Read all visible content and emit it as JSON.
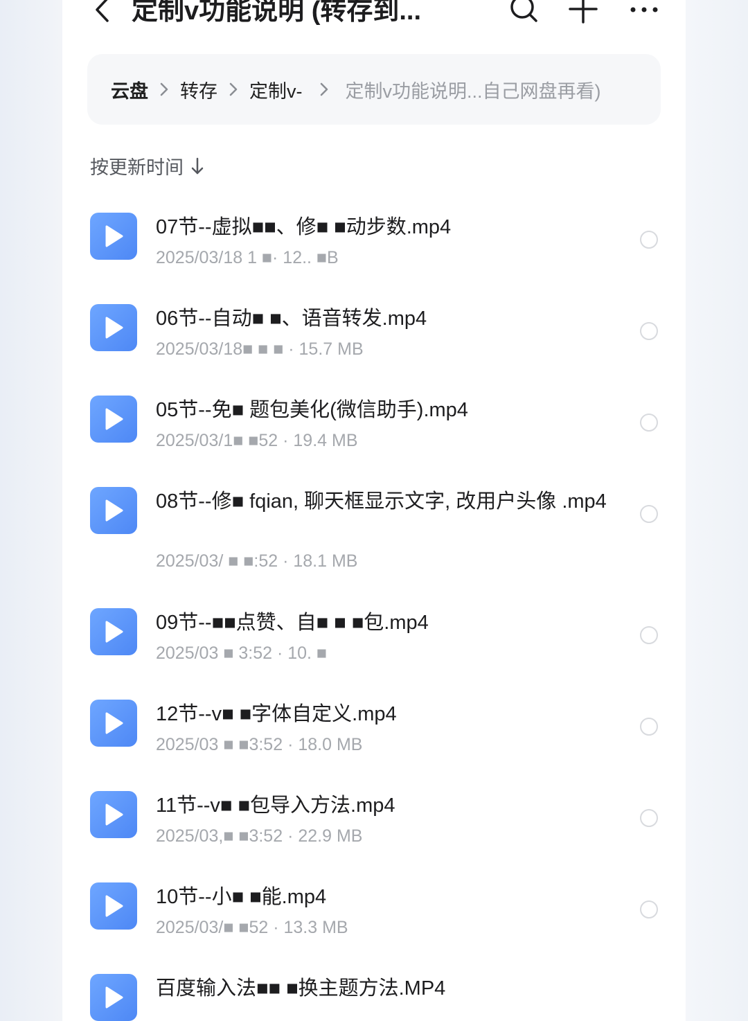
{
  "header": {
    "title": "定制v功能说明 (转存到...",
    "icons": [
      "back-icon",
      "search-icon",
      "plus-icon",
      "more-icon"
    ]
  },
  "breadcrumb": {
    "items": [
      "云盘",
      "转存",
      "定制v-",
      "定制v功能说明...自己网盘再看)"
    ]
  },
  "sort": {
    "label": "按更新时间"
  },
  "files": [
    {
      "name": "07节--虚拟■■、修■ ■动步数.mp4",
      "meta": "2025/03/18 1  ■· 12.. ■B"
    },
    {
      "name": "06节--自动■ ■、语音转发.mp4",
      "meta": "2025/03/18■ ■ ■ · 15.7 MB"
    },
    {
      "name": "05节--免■ 题包美化(微信助手).mp4",
      "meta": "2025/03/1■ ■52 · 19.4 MB"
    },
    {
      "name": "08节--修■ fqian, 聊天框显示文字, 改用户头像 .mp4",
      "meta": "2025/03/ ■ ■:52 · 18.1 MB"
    },
    {
      "name": "09节--■■点赞、自■ ■ ■包.mp4",
      "meta": "2025/03 ■ 3:52 · 10. ■"
    },
    {
      "name": "12节--v■ ■字体自定义.mp4",
      "meta": "2025/03 ■ ■3:52 · 18.0 MB"
    },
    {
      "name": "11节--v■ ■包导入方法.mp4",
      "meta": "2025/03,■ ■3:52 · 22.9 MB"
    },
    {
      "name": "10节--小■ ■能.mp4",
      "meta": "2025/03/■ ■52 · 13.3 MB"
    },
    {
      "name": "百度输入法■■ ■换主题方法.MP4",
      "meta": ""
    }
  ],
  "colors": {
    "accent": "#4e88f5",
    "meta_text": "#a5a8ad",
    "breadcrumb_bg": "#f6f7f9"
  }
}
